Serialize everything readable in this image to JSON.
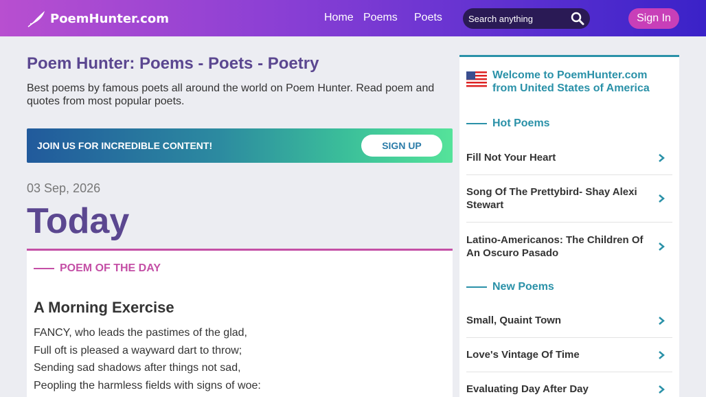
{
  "header": {
    "logo_text": "PoemHunter.com",
    "nav": [
      "Home",
      "Poems",
      "Poets"
    ],
    "search_placeholder": "Search anything",
    "signin_label": "Sign In"
  },
  "main": {
    "title": "Poem Hunter: Poems - Poets - Poetry",
    "description": "Best poems by famous poets all around the world on Poem Hunter. Read poem and quotes from most popular poets.",
    "banner_text": "JOIN US FOR INCREDIBLE CONTENT!",
    "signup_label": "SIGN UP",
    "date": "03 Sep, 2026",
    "today": "Today"
  },
  "poem_of_day": {
    "label": "POEM OF THE DAY",
    "title": "A Morning Exercise",
    "lines": [
      "FANCY, who leads the pastimes of the glad,",
      "Full oft is pleased a wayward dart to throw;",
      "Sending sad shadows after things not sad,",
      "Peopling the harmless fields with signs of woe:"
    ]
  },
  "sidebar": {
    "welcome": "Welcome to PoemHunter.com from United States of America",
    "hot_label": "Hot Poems",
    "hot_poems": [
      "Fill Not Your Heart",
      "Song Of The Prettybird- Shay Alexi Stewart",
      "Latino-Americanos: The Children Of An Oscuro Pasado"
    ],
    "new_label": "New Poems",
    "new_poems": [
      "Small, Quaint Town",
      "Love's Vintage Of Time",
      "Evaluating Day After Day"
    ]
  },
  "colors": {
    "accent_purple": "#5b4790",
    "accent_pink": "#c44fa6",
    "accent_teal": "#2a91a8"
  },
  "icons": [
    "quill-logo-icon",
    "search-icon",
    "us-flag-icon",
    "chevron-right-icon"
  ]
}
